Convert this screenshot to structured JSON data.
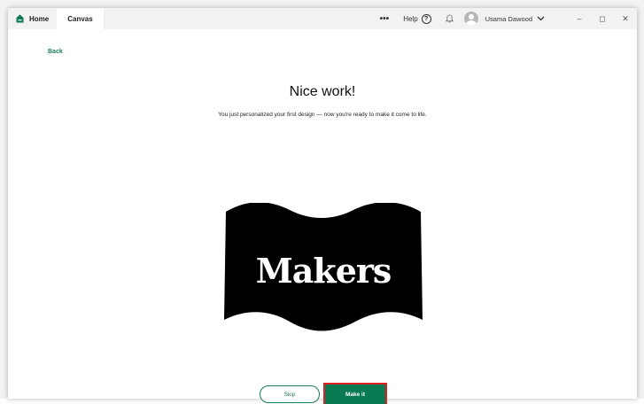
{
  "titlebar": {
    "tabs": [
      {
        "label": "Home",
        "icon": "home-icon"
      },
      {
        "label": "Canvas"
      }
    ],
    "more_label": "•••",
    "help_label": "Help",
    "help_icon_glyph": "?",
    "user_name": "Usama Dawood",
    "window_controls": {
      "minimize": "–",
      "maximize": "◻",
      "close": "✕"
    }
  },
  "main": {
    "back_label": "Back",
    "title": "Nice work!",
    "subtitle": "You just personalized your first design — now you're ready to make it come to life.",
    "design_text": "Makers"
  },
  "footer": {
    "skip_label": "Skip",
    "make_label": "Make it"
  },
  "colors": {
    "brand_green": "#0a7a52",
    "highlight_red": "#e02020",
    "design_fill": "#000000"
  }
}
